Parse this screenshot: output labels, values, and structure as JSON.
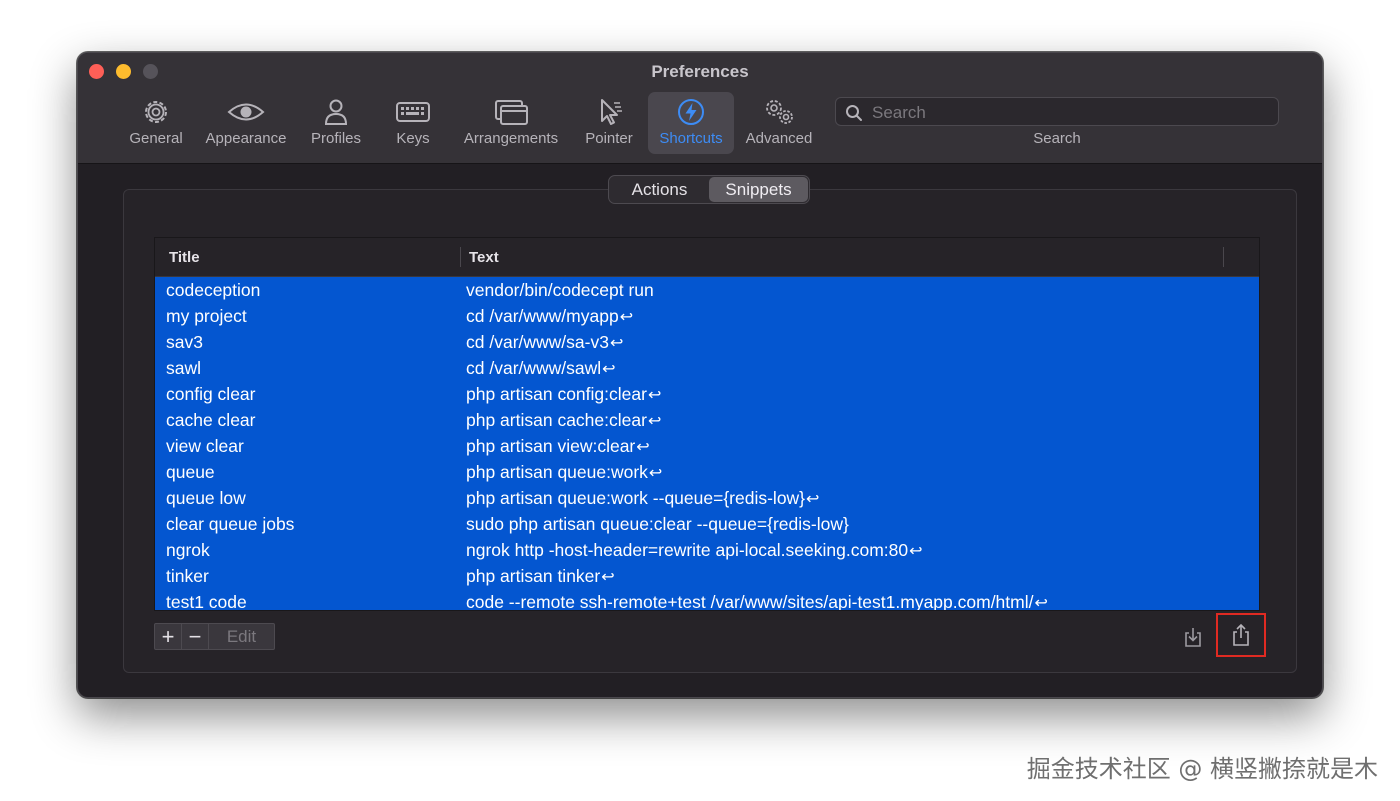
{
  "window": {
    "title": "Preferences"
  },
  "toolbar": {
    "items": [
      {
        "label": "General",
        "icon": "gear-icon"
      },
      {
        "label": "Appearance",
        "icon": "eye-icon"
      },
      {
        "label": "Profiles",
        "icon": "person-icon"
      },
      {
        "label": "Keys",
        "icon": "keyboard-icon"
      },
      {
        "label": "Arrangements",
        "icon": "windows-icon"
      },
      {
        "label": "Pointer",
        "icon": "cursor-icon"
      },
      {
        "label": "Shortcuts",
        "icon": "lightning-icon",
        "active": true
      },
      {
        "label": "Advanced",
        "icon": "gears-icon"
      }
    ],
    "search": {
      "placeholder": "Search",
      "caption": "Search"
    }
  },
  "segmented": {
    "actions": "Actions",
    "snippets": "Snippets",
    "selected": "Snippets"
  },
  "table": {
    "columns": [
      "Title",
      "Text"
    ],
    "rows": [
      {
        "title": "codeception",
        "text": "vendor/bin/codecept run",
        "ret": ""
      },
      {
        "title": "my project",
        "text": "cd /var/www/myapp",
        "ret": "↩"
      },
      {
        "title": "sav3",
        "text": "cd /var/www/sa-v3",
        "ret": "↩"
      },
      {
        "title": "sawl",
        "text": "cd /var/www/sawl",
        "ret": "↩"
      },
      {
        "title": "config clear",
        "text": "php artisan config:clear",
        "ret": "↩"
      },
      {
        "title": "cache clear",
        "text": "php artisan cache:clear",
        "ret": "↩"
      },
      {
        "title": "view clear",
        "text": "php artisan view:clear",
        "ret": "↩"
      },
      {
        "title": "queue",
        "text": "php artisan queue:work",
        "ret": "↩"
      },
      {
        "title": "queue low",
        "text": "php artisan queue:work --queue={redis-low}",
        "ret": "↩"
      },
      {
        "title": "clear queue jobs",
        "text": "sudo php artisan queue:clear --queue={redis-low}",
        "ret": ""
      },
      {
        "title": "ngrok",
        "text": "ngrok http -host-header=rewrite api-local.seeking.com:80",
        "ret": "↩"
      },
      {
        "title": "tinker",
        "text": "php artisan tinker",
        "ret": "↩"
      },
      {
        "title": "test1 code",
        "text": "code --remote ssh-remote+test /var/www/sites/api-test1.myapp.com/html/",
        "ret": "↩"
      }
    ]
  },
  "footer": {
    "add": "+",
    "remove": "−",
    "edit": "Edit"
  },
  "colors": {
    "accent": "#3d8cf5",
    "selection": "#0456d0",
    "highlight_border": "#e02a22"
  },
  "watermark": "掘金技术社区 @ 横竖撇捺就是木"
}
